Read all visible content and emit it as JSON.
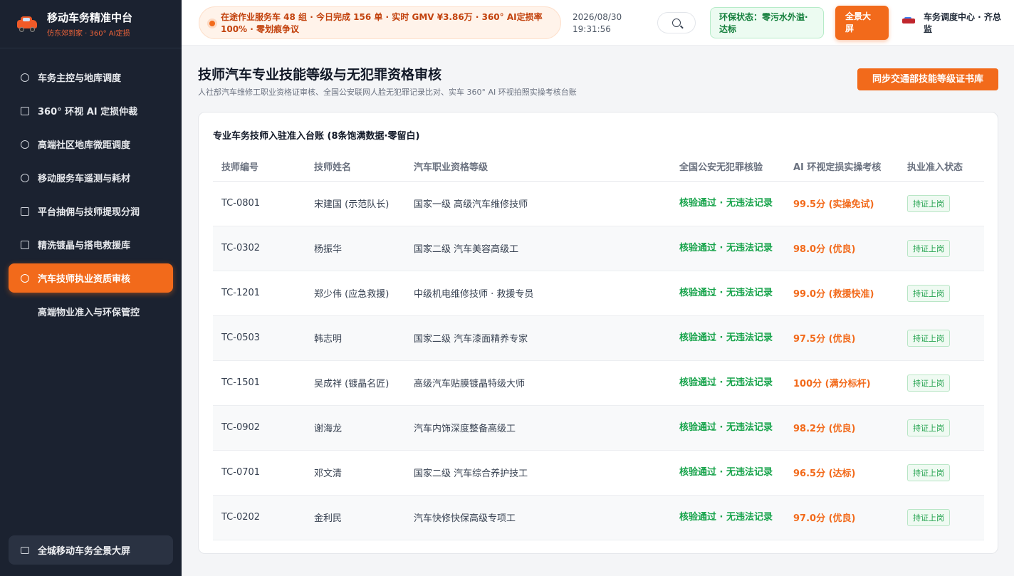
{
  "brand": {
    "title": "移动车务精准中台",
    "subtitle": "仿东郊到家 · 360° AI定损"
  },
  "sidebar": {
    "items": [
      {
        "label": "车务主控与地库调度",
        "icon": "dashboard-icon",
        "active": false
      },
      {
        "label": "360° 环视 AI 定损仲裁",
        "icon": "camera-icon",
        "active": false
      },
      {
        "label": "高端社区地库微距调度",
        "icon": "location-pin-icon",
        "active": false
      },
      {
        "label": "移动服务车遥测与耗材",
        "icon": "gear-icon",
        "active": false
      },
      {
        "label": "平台抽佣与技师提现分润",
        "icon": "database-icon",
        "active": false
      },
      {
        "label": "精洗镀晶与搭电救援库",
        "icon": "bag-icon",
        "active": false
      },
      {
        "label": "汽车技师执业资质审核",
        "icon": "user-icon",
        "active": true
      },
      {
        "label": "高端物业准入与环保管控",
        "icon": "",
        "active": false
      }
    ],
    "bottom_label": "全城移动车务全景大屏",
    "bottom_icon": "monitor-icon"
  },
  "header": {
    "ticker": "在途作业服务车 48 组 · 今日完成 156 单 · 实时 GMV ¥3.86万 · 360° AI定损率 100% · 零划痕争议",
    "date": "2026/08/30",
    "time": "19:31:56",
    "env_status": "环保状态：零污水外溢·达标",
    "fullscreen_label": "全景大屏",
    "user_name": "车务调度中心 · 齐总监"
  },
  "page": {
    "title": "技师汽车专业技能等级与无犯罪资格审核",
    "subtitle": "人社部汽车维修工职业资格证审核、全国公安联网人脸无犯罪记录比对、实车 360° AI 环视拍照实操考核台账",
    "sync_button": "同步交通部技能等级证书库"
  },
  "ledger": {
    "title": "专业车务技师入驻准入台账 (8条饱满数据·零留白)",
    "columns": [
      "技师编号",
      "技师姓名",
      "汽车职业资格等级",
      "全国公安无犯罪核验",
      "AI 环视定损实操考核",
      "执业准入状态"
    ],
    "rows": [
      {
        "id": "TC-0801",
        "name": "宋建国 (示范队长)",
        "level": "国家一级 高级汽车维修技师",
        "crime_check": "核验通过 · 无违法记录",
        "score": "99.5分 (实操免试)",
        "status": "持证上岗"
      },
      {
        "id": "TC-0302",
        "name": "杨振华",
        "level": "国家二级 汽车美容高级工",
        "crime_check": "核验通过 · 无违法记录",
        "score": "98.0分 (优良)",
        "status": "持证上岗"
      },
      {
        "id": "TC-1201",
        "name": "郑少伟 (应急救援)",
        "level": "中级机电维修技师 · 救援专员",
        "crime_check": "核验通过 · 无违法记录",
        "score": "99.0分 (救援快准)",
        "status": "持证上岗"
      },
      {
        "id": "TC-0503",
        "name": "韩志明",
        "level": "国家二级 汽车漆面精养专家",
        "crime_check": "核验通过 · 无违法记录",
        "score": "97.5分 (优良)",
        "status": "持证上岗"
      },
      {
        "id": "TC-1501",
        "name": "吴成祥 (镀晶名匠)",
        "level": "高级汽车贴膜镀晶特级大师",
        "crime_check": "核验通过 · 无违法记录",
        "score": "100分 (满分标杆)",
        "status": "持证上岗"
      },
      {
        "id": "TC-0902",
        "name": "谢海龙",
        "level": "汽车内饰深度整备高级工",
        "crime_check": "核验通过 · 无违法记录",
        "score": "98.2分 (优良)",
        "status": "持证上岗"
      },
      {
        "id": "TC-0701",
        "name": "邓文清",
        "level": "国家二级 汽车综合养护技工",
        "crime_check": "核验通过 · 无违法记录",
        "score": "96.5分 (达标)",
        "status": "持证上岗"
      },
      {
        "id": "TC-0202",
        "name": "金利民",
        "level": "汽车快修快保高级专项工",
        "crime_check": "核验通过 · 无违法记录",
        "score": "97.0分 (优良)",
        "status": "持证上岗"
      }
    ]
  },
  "colors": {
    "accent": "#f26a1b",
    "sidebar_bg": "#1b2230",
    "success": "#16a34a"
  }
}
